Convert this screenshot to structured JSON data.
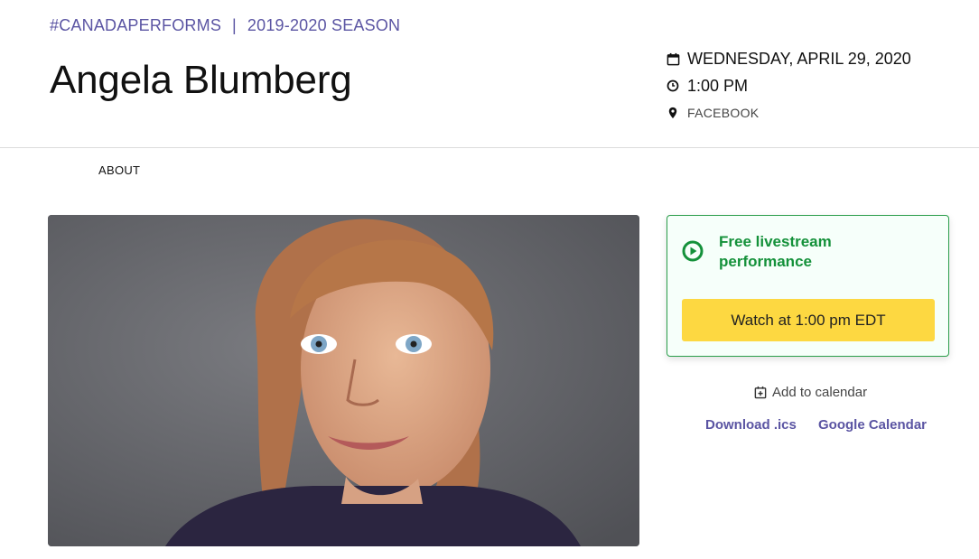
{
  "breadcrumb": {
    "tag": "#CANADAPERFORMS",
    "separator": "|",
    "season": "2019-2020 SEASON"
  },
  "event": {
    "title": "Angela Blumberg",
    "date": "WEDNESDAY, APRIL 29, 2020",
    "time": "1:00 PM",
    "location": "FACEBOOK"
  },
  "tabs": {
    "about": "ABOUT"
  },
  "livestream": {
    "label": "Free livestream performance",
    "button": "Watch at 1:00 pm EDT"
  },
  "calendar": {
    "add_label": "Add to calendar",
    "download": "Download .ics",
    "google": "Google Calendar"
  },
  "colors": {
    "accent": "#5b55a3",
    "green": "#14913a",
    "button": "#fdd841"
  },
  "icons": [
    "calendar-icon",
    "clock-icon",
    "location-pin-icon",
    "play-circle-icon",
    "calendar-plus-icon"
  ]
}
